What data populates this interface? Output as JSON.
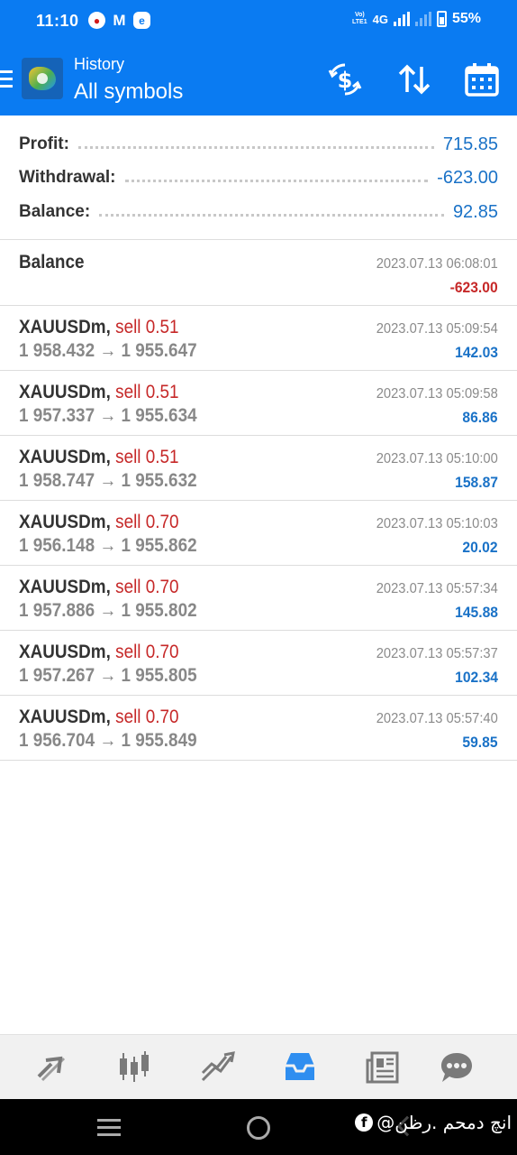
{
  "status_bar": {
    "time": "11:10",
    "network": "4G",
    "volte": "VoLTE",
    "battery": "55%"
  },
  "app_bar": {
    "title": "History",
    "subtitle": "All symbols",
    "actions": [
      "currency-swap-icon",
      "sort-icon",
      "calendar-icon"
    ]
  },
  "summary": {
    "profit_label": "Profit:",
    "profit_value": "715.85",
    "withdrawal_label": "Withdrawal:",
    "withdrawal_value": "-623.00",
    "balance_label": "Balance:",
    "balance_value": "92.85"
  },
  "balance_entry": {
    "label": "Balance",
    "time": "2023.07.13 06:08:01",
    "amount": "-623.00"
  },
  "deals": [
    {
      "symbol": "XAUUSDm,",
      "side": "sell 0.51",
      "open": "1 958.432",
      "close": "1 955.647",
      "time": "2023.07.13 05:09:54",
      "profit": "142.03"
    },
    {
      "symbol": "XAUUSDm,",
      "side": "sell 0.51",
      "open": "1 957.337",
      "close": "1 955.634",
      "time": "2023.07.13 05:09:58",
      "profit": "86.86"
    },
    {
      "symbol": "XAUUSDm,",
      "side": "sell 0.51",
      "open": "1 958.747",
      "close": "1 955.632",
      "time": "2023.07.13 05:10:00",
      "profit": "158.87"
    },
    {
      "symbol": "XAUUSDm,",
      "side": "sell 0.70",
      "open": "1 956.148",
      "close": "1 955.862",
      "time": "2023.07.13 05:10:03",
      "profit": "20.02"
    },
    {
      "symbol": "XAUUSDm,",
      "side": "sell 0.70",
      "open": "1 957.886",
      "close": "1 955.802",
      "time": "2023.07.13 05:57:34",
      "profit": "145.88"
    },
    {
      "symbol": "XAUUSDm,",
      "side": "sell 0.70",
      "open": "1 957.267",
      "close": "1 955.805",
      "time": "2023.07.13 05:57:37",
      "profit": "102.34"
    },
    {
      "symbol": "XAUUSDm,",
      "side": "sell 0.70",
      "open": "1 956.704",
      "close": "1 955.849",
      "time": "2023.07.13 05:57:40",
      "profit": "59.85"
    }
  ],
  "arrow": "→",
  "bottom_nav": [
    "quotes-icon",
    "chart-icon",
    "trade-icon",
    "history-icon",
    "news-icon",
    "chat-icon"
  ],
  "watermark": "انچ دمحم .رظن@",
  "colors": {
    "accent": "#0a7bf2",
    "positive": "#1a72c7",
    "negative": "#c62828"
  }
}
